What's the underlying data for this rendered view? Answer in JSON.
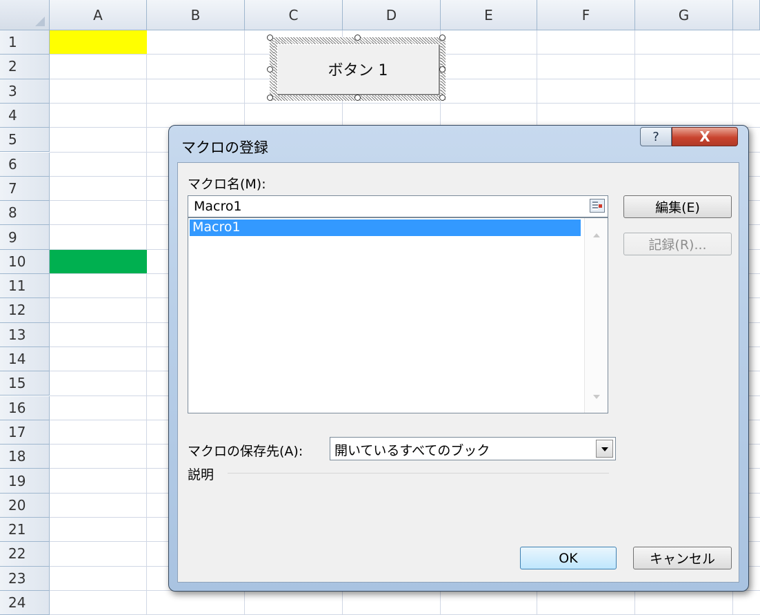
{
  "sheet": {
    "columns": [
      "A",
      "B",
      "C",
      "D",
      "E",
      "F",
      "G"
    ],
    "rows": [
      "1",
      "2",
      "3",
      "4",
      "5",
      "6",
      "7",
      "8",
      "9",
      "10",
      "11",
      "12",
      "13",
      "14",
      "15",
      "16",
      "17",
      "18",
      "19",
      "20",
      "21",
      "22",
      "23",
      "24"
    ],
    "fills": {
      "A1": "#ffff00",
      "A10": "#00b050"
    },
    "form_button_label": "ボタン 1"
  },
  "dialog": {
    "title": "マクロの登録",
    "help_label": "?",
    "close_label": "X",
    "macro_name_label": "マクロ名(M):",
    "macro_name_value": "Macro1",
    "macro_list": [
      "Macro1"
    ],
    "selected_macro": "Macro1",
    "edit_button": "編集(E)",
    "record_button": "記録(R)...",
    "store_in_label": "マクロの保存先(A):",
    "store_in_value": "開いているすべてのブック",
    "description_label": "説明",
    "ok_button": "OK",
    "cancel_button": "キャンセル"
  }
}
